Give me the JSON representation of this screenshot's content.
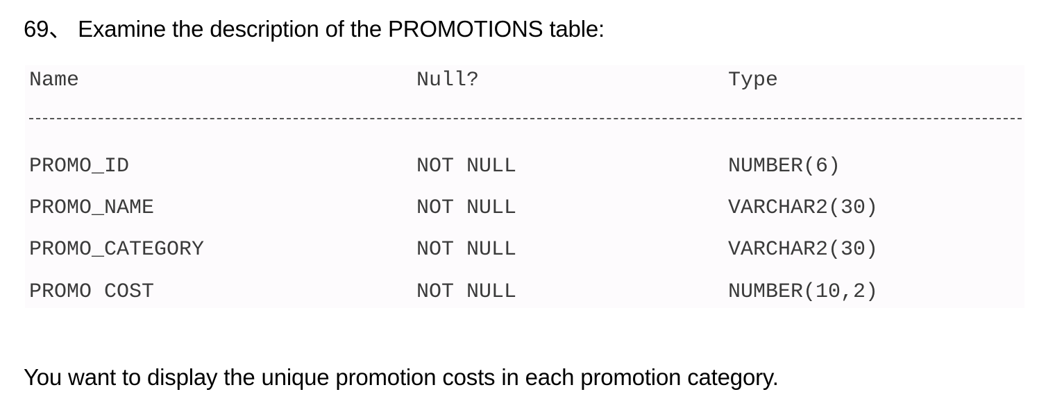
{
  "question": {
    "title": "69、 Examine the description of the PROMOTIONS table:",
    "prompt": "You want to display the unique promotion costs in each promotion category."
  },
  "table": {
    "headers": {
      "name": "Name",
      "null": "Null?",
      "type": "Type"
    },
    "divider": "- - - - - - - - - - - - - - - - - - - -",
    "rows": [
      {
        "name": "PROMO_ID",
        "null": "NOT NULL",
        "type": "NUMBER(6)"
      },
      {
        "name": "PROMO_NAME",
        "null": "NOT NULL",
        "type": "VARCHAR2(30)"
      },
      {
        "name": "PROMO_CATEGORY",
        "null": "NOT NULL",
        "type": "VARCHAR2(30)"
      },
      {
        "name": "PROMO COST",
        "null": "NOT NULL",
        "type": "NUMBER(10,2)"
      }
    ]
  }
}
